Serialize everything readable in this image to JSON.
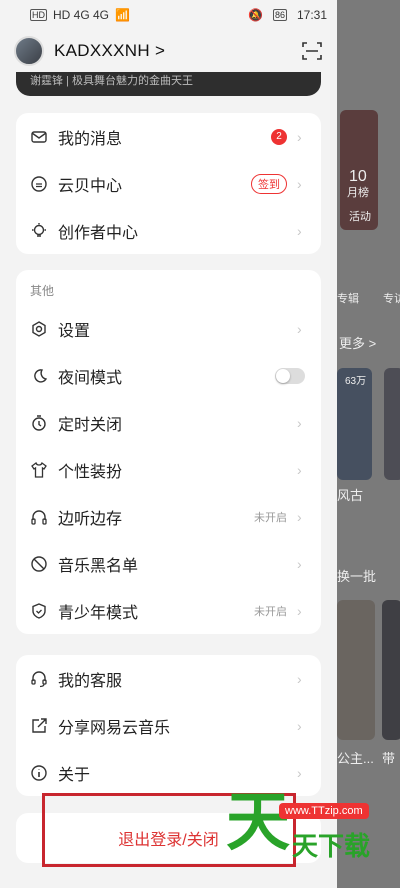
{
  "status_bar": {
    "left": "HD 4G 4G",
    "battery": "86",
    "time": "17:31"
  },
  "header": {
    "username": "KADXXXNH >",
    "banner_text": "谢霆锋 | 极具舞台魅力的金曲天王"
  },
  "card1": {
    "items": [
      {
        "label": "我的消息",
        "badge": "2"
      },
      {
        "label": "云贝中心",
        "action": "签到"
      },
      {
        "label": "创作者中心"
      }
    ]
  },
  "card2": {
    "section": "其他",
    "items": [
      {
        "label": "设置"
      },
      {
        "label": "夜间模式"
      },
      {
        "label": "定时关闭"
      },
      {
        "label": "个性装扮"
      },
      {
        "label": "边听边存",
        "status": "未开启"
      },
      {
        "label": "音乐黑名单"
      },
      {
        "label": "青少年模式",
        "status": "未开启"
      }
    ]
  },
  "card3": {
    "items": [
      {
        "label": "我的客服"
      },
      {
        "label": "分享网易云音乐"
      },
      {
        "label": "关于"
      }
    ]
  },
  "logout": "退出登录/关闭",
  "right_panel": {
    "text1": "活动",
    "text2": "专辑",
    "text3": "专访",
    "text4": "更多 >",
    "text5": "63万",
    "text6": "风古",
    "text7": "换一批",
    "text8": "公主...",
    "text9": "带",
    "month": "月榜",
    "day": "10"
  },
  "watermark": {
    "url": "www.TTzip.com",
    "big": "天",
    "small": "天下载"
  },
  "colors": {
    "accent": "#e33333",
    "highlight": "#c8262e"
  }
}
